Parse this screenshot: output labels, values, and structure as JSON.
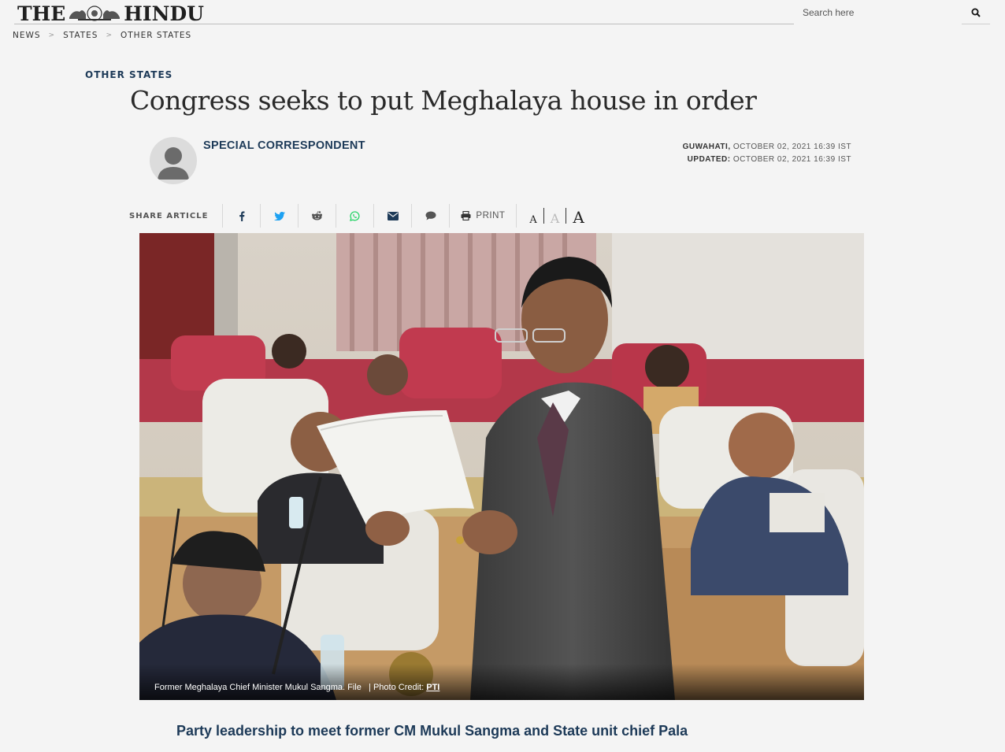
{
  "header": {
    "logo_left": "THE",
    "logo_right": "HINDU",
    "search_placeholder": "Search here"
  },
  "breadcrumb": [
    "NEWS",
    "STATES",
    "OTHER STATES"
  ],
  "article": {
    "section": "OTHER STATES",
    "title": "Congress seeks to put Meghalaya house in order",
    "author": "SPECIAL CORRESPONDENT",
    "location": "GUWAHATI,",
    "published": "OCTOBER 02, 2021 16:39 IST",
    "updated_label": "UPDATED:",
    "updated": "OCTOBER 02, 2021 16:39 IST",
    "subheading": "Party leadership to meet former CM Mukul Sangma and State unit chief Pala"
  },
  "share": {
    "label": "SHARE ARTICLE",
    "items": [
      "facebook-icon",
      "twitter-icon",
      "reddit-icon",
      "whatsapp-icon",
      "email-icon",
      "comment-icon",
      "printer-icon"
    ],
    "print_label": "PRINT",
    "font_small": "A",
    "font_medium": "A",
    "font_large": "A"
  },
  "photo": {
    "caption": "Former Meghalaya Chief Minister Mukul Sangma. File",
    "credit_label": "| Photo Credit:",
    "credit": "PTI"
  },
  "colors": {
    "navy": "#1d3a58",
    "twitter": "#1da1f2",
    "whatsapp": "#25d366",
    "background": "#f4f4f4"
  }
}
